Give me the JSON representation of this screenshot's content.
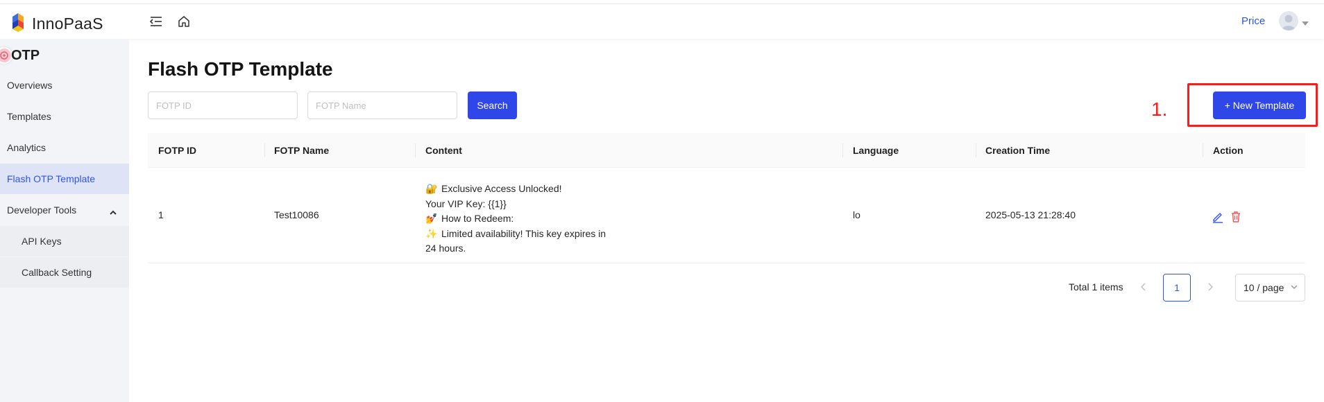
{
  "header": {
    "brand": "InnoPaaS",
    "price_label": "Price"
  },
  "sidebar": {
    "title": "OTP",
    "items": [
      {
        "label": "Overviews"
      },
      {
        "label": "Templates"
      },
      {
        "label": "Analytics"
      },
      {
        "label": "Flash OTP Template"
      },
      {
        "label": "Developer Tools"
      },
      {
        "label": "API Keys"
      },
      {
        "label": "Callback Setting"
      }
    ]
  },
  "main": {
    "title": "Flash OTP Template",
    "search": {
      "id_placeholder": "FOTP ID",
      "name_placeholder": "FOTP Name",
      "button": "Search"
    },
    "new_button": "+ New Template",
    "annotation": "1."
  },
  "table": {
    "columns": [
      "FOTP ID",
      "FOTP Name",
      "Content",
      "Language",
      "Creation Time",
      "Action"
    ],
    "rows": [
      {
        "id": "1",
        "name": "Test10086",
        "content": [
          {
            "emoji": "🔐",
            "text": "Exclusive Access Unlocked!"
          },
          {
            "emoji": "",
            "text": "Your VIP Key: {{1}}"
          },
          {
            "emoji": "💅",
            "text": "How to Redeem:"
          },
          {
            "emoji": "✨",
            "text": "Limited availability! This key expires in"
          },
          {
            "emoji": "",
            "text": "24 hours."
          }
        ],
        "language": "lo",
        "creation_time": "2025-05-13 21:28:40"
      }
    ]
  },
  "pagination": {
    "total": "Total 1 items",
    "current_page": "1",
    "page_size": "10 / page"
  },
  "colors": {
    "primary": "#2f46e8",
    "link": "#2f54eb",
    "danger": "#ff4d4f",
    "annotation": "#ff1a1a"
  }
}
